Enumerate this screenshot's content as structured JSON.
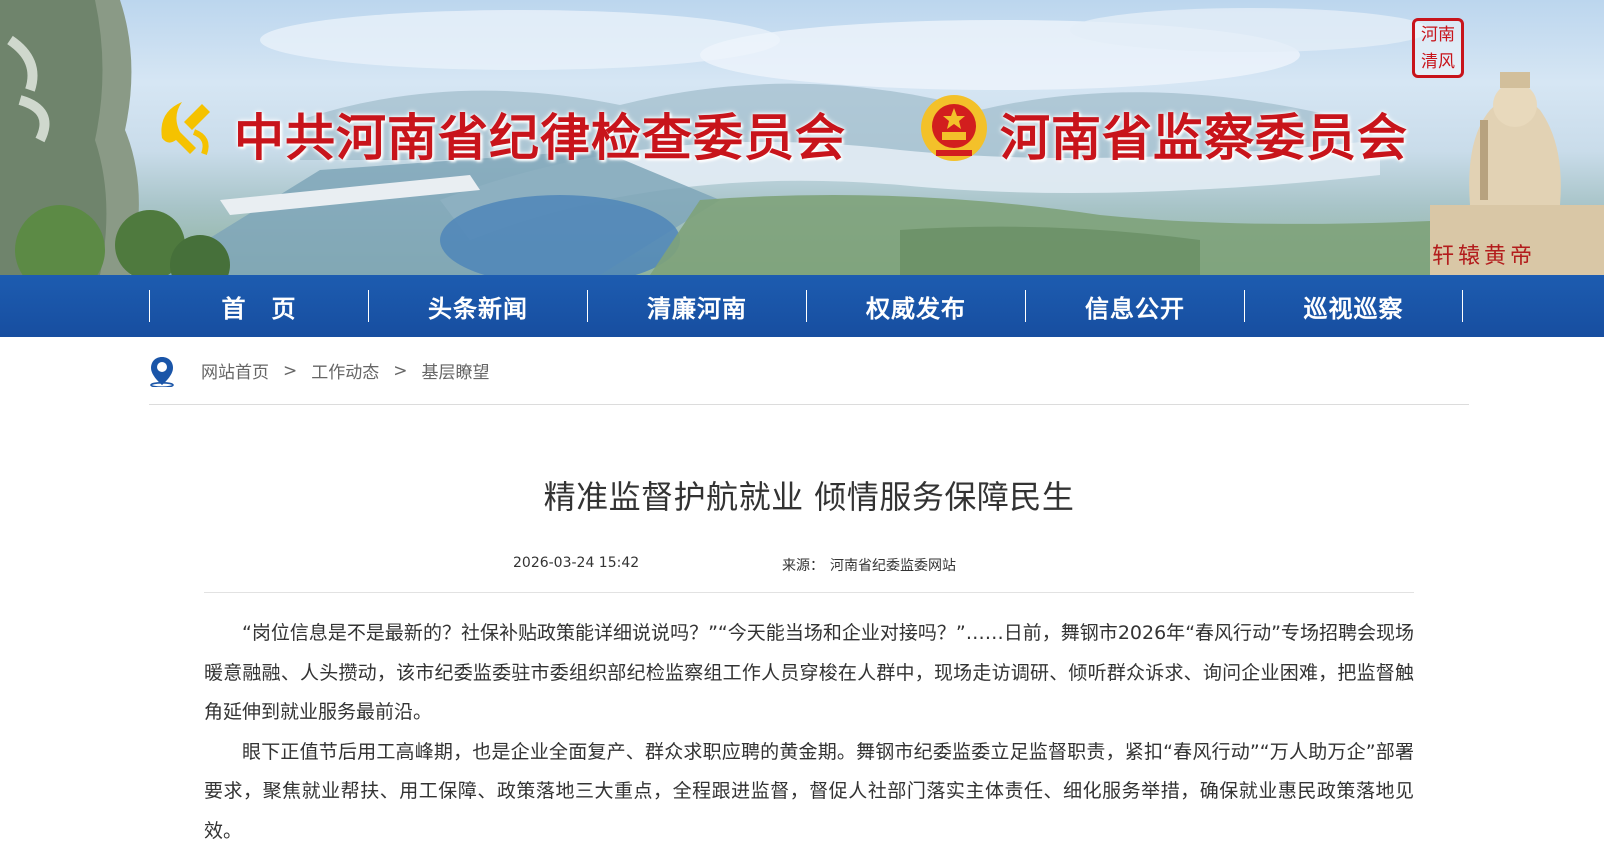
{
  "banner": {
    "org_left": "中共河南省纪律检查委员会",
    "org_right": "河南省监察委员会",
    "seal_text": "河南清风",
    "statue_caption": "轩辕黄帝",
    "colors": {
      "title_red": "#c8141b",
      "nav_blue": "#1a55a8"
    }
  },
  "nav": {
    "items": [
      "首　页",
      "头条新闻",
      "清廉河南",
      "权威发布",
      "信息公开",
      "巡视巡察"
    ]
  },
  "breadcrumb": {
    "icon": "location-pin-icon",
    "items": [
      "网站首页",
      "工作动态",
      "基层瞭望"
    ],
    "separator": ">"
  },
  "article": {
    "title": "精准监督护航就业 倾情服务保障民生",
    "date": "2026-03-24 15:42",
    "source_label": "来源：",
    "source": "河南省纪委监委网站",
    "paragraphs": [
      "“岗位信息是不是最新的？社保补贴政策能详细说说吗？”“今天能当场和企业对接吗？”……日前，舞钢市2026年“春风行动”专场招聘会现场暖意融融、人头攒动，该市纪委监委驻市委组织部纪检监察组工作人员穿梭在人群中，现场走访调研、倾听群众诉求、询问企业困难，把监督触角延伸到就业服务最前沿。",
      "眼下正值节后用工高峰期，也是企业全面复产、群众求职应聘的黄金期。舞钢市纪委监委立足监督职责，紧扣“春风行动”“万人助万企”部署要求，聚焦就业帮扶、用工保障、政策落地三大重点，全程跟进监督，督促人社部门落实主体责任、细化服务举措，确保就业惠民政策落地见效。"
    ]
  }
}
